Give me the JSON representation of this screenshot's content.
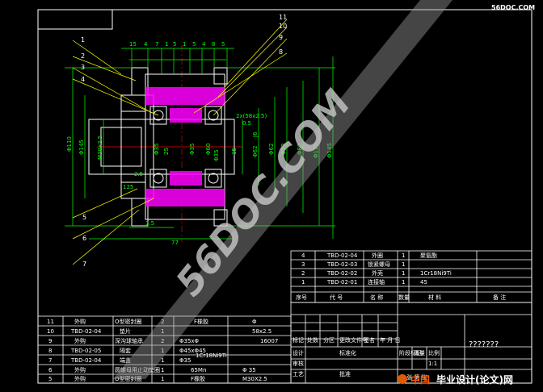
{
  "balloons": {
    "left": [
      "1",
      "2",
      "3",
      "4",
      "5",
      "6",
      "7"
    ],
    "right": [
      "11",
      "10",
      "9",
      "8"
    ]
  },
  "dims": {
    "top": [
      "15",
      "4",
      "7",
      "1",
      "5",
      "1",
      "5",
      "4",
      "8",
      "5"
    ],
    "bottom_span": "77",
    "bottom_small": "3.5",
    "bearing_note": "2x(58x2.5)",
    "bearing_sub": "0.5",
    "left_vertical": [
      "Φ110",
      "Φ145",
      "M30x2.5"
    ],
    "center_vertical": [
      "25",
      "Φ35",
      "Φ60",
      "15"
    ],
    "right_vertical": [
      "Φ62",
      "J6",
      "Φ62",
      "Φ52",
      "Φ80",
      "Φ120",
      "Φ145"
    ],
    "misc": [
      "2.5",
      "Φ35",
      "Φ35",
      "125"
    ]
  },
  "parts_upper": {
    "rows": [
      {
        "no": "4",
        "code": "TBD-02-04",
        "name": "外圈",
        "qty": "1",
        "material": "聚氨酯",
        "note": ""
      },
      {
        "no": "3",
        "code": "TBD-02-03",
        "name": "锁紧螺母",
        "qty": "1",
        "material": "",
        "note": ""
      },
      {
        "no": "2",
        "code": "TBD-02-02",
        "name": "外壳",
        "qty": "1",
        "material": "1Cr18Ni9Ti",
        "note": ""
      },
      {
        "no": "1",
        "code": "TBD-02-01",
        "name": "连接轴",
        "qty": "1",
        "material": "45",
        "note": ""
      }
    ],
    "header": [
      "序号",
      "代 号",
      "名 称",
      "数量",
      "材 料",
      "备 注"
    ]
  },
  "parts_lower": {
    "rows": [
      {
        "no": "11",
        "code": "外购",
        "name": "O型密封圈",
        "qty": "2",
        "material": "F橡胶",
        "spec": "Φ",
        "extra": ""
      },
      {
        "no": "10",
        "code": "TBD-02-04",
        "name": "垫片",
        "qty": "1",
        "material": "",
        "spec": "58x2.5",
        "extra": ""
      },
      {
        "no": "9",
        "code": "外购",
        "name": "深沟球轴承",
        "qty": "2",
        "material": "Φ35xΦ",
        "spec": "",
        "extra": "16007"
      },
      {
        "no": "8",
        "code": "TBD-02-05",
        "name": "隔套",
        "qty": "1",
        "material": "Φ45xΦ45",
        "spec": "",
        "extra": ""
      },
      {
        "no": "7",
        "code": "TBD-02-04",
        "name": "端盖",
        "qty": "1",
        "material": "Φ35",
        "spec": "1Cr18Ni9Ti",
        "extra": ""
      },
      {
        "no": "6",
        "code": "外购",
        "name": "圆螺母用止动垫圈",
        "qty": "1",
        "material": "65Mn",
        "spec": "Φ 35",
        "extra": ""
      },
      {
        "no": "5",
        "code": "外购",
        "name": "O型密封圈",
        "qty": "1",
        "material": "F橡胶",
        "spec": "M30X2.5",
        "extra": ""
      }
    ]
  },
  "title_block": {
    "labels": [
      "标记",
      "处数",
      "分区",
      "更改文件号",
      "签名",
      "年 月 日"
    ],
    "labels2": [
      "设计",
      "标准化",
      "阶段标记",
      "重量",
      "比例"
    ],
    "rows_left": [
      "审核",
      "工艺",
      "批准"
    ],
    "scale": "1:1",
    "drawing_name": "???????",
    "sheet": "共 张 第 张"
  },
  "watermarks": {
    "diagonal": "56DOC.COM",
    "corner_brand": "56DOC.COM",
    "footer_cn": "中国",
    "footer_rest": "毕业设计(论文)网"
  },
  "colors": {
    "frame": "#ffffff",
    "outline": "#ffffff",
    "dims": "#00ff00",
    "hatch": "#ff00ff",
    "center": "#ff0000",
    "leader": "#ffff00",
    "watermark": "#b4b4b4",
    "table": "#ffffff"
  }
}
